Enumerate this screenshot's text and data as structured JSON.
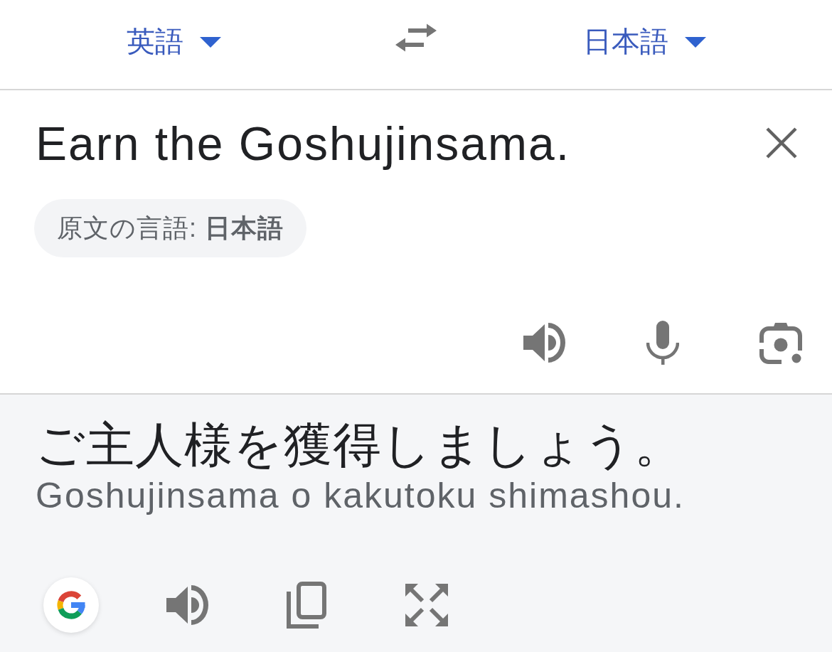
{
  "header": {
    "source_language": "英語",
    "target_language": "日本語"
  },
  "input": {
    "text": "Earn the Goshujinsama.",
    "detected_language": "原文の言語: **日本語**"
  },
  "output": {
    "translation": "ご主人様を獲得しましょう。",
    "romanization": "Goshujinsama o kakutoku shimashou."
  }
}
